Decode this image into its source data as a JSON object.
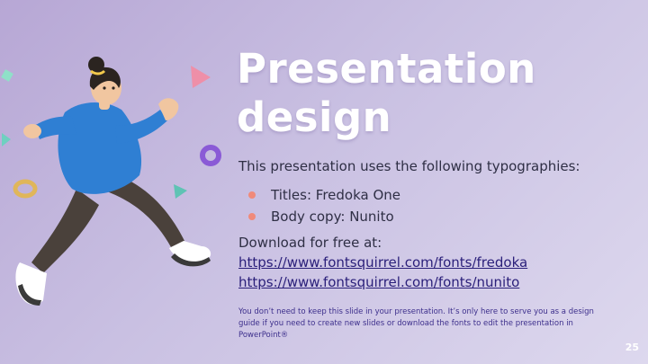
{
  "slide": {
    "title": "Presentation design",
    "intro": "This presentation uses the following typographies:",
    "fonts": [
      "Titles: Fredoka One",
      "Body copy: Nunito"
    ],
    "download_label": "Download for free at:",
    "links": [
      "https://www.fontsquirrel.com/fonts/fredoka",
      "https://www.fontsquirrel.com/fonts/nunito"
    ],
    "note": "You don’t need to keep this slide in your presentation. It’s only here to serve you as a design guide if you need to create new slides or download the fonts to edit the presentation in PowerPoint®",
    "page_number": "25"
  },
  "colors": {
    "background_start": "#b7a7d5",
    "background_end": "#ddd8ee",
    "title": "#ffffff",
    "bullet": "#f08a7a",
    "link": "#2a1f7a"
  },
  "illustration": {
    "subject": "running-person-3d-illustration",
    "decorations": [
      "pink-triangle-icon",
      "purple-ring-icon",
      "gold-ring-icon",
      "teal-triangle-icon",
      "mint-cube-icon"
    ]
  }
}
